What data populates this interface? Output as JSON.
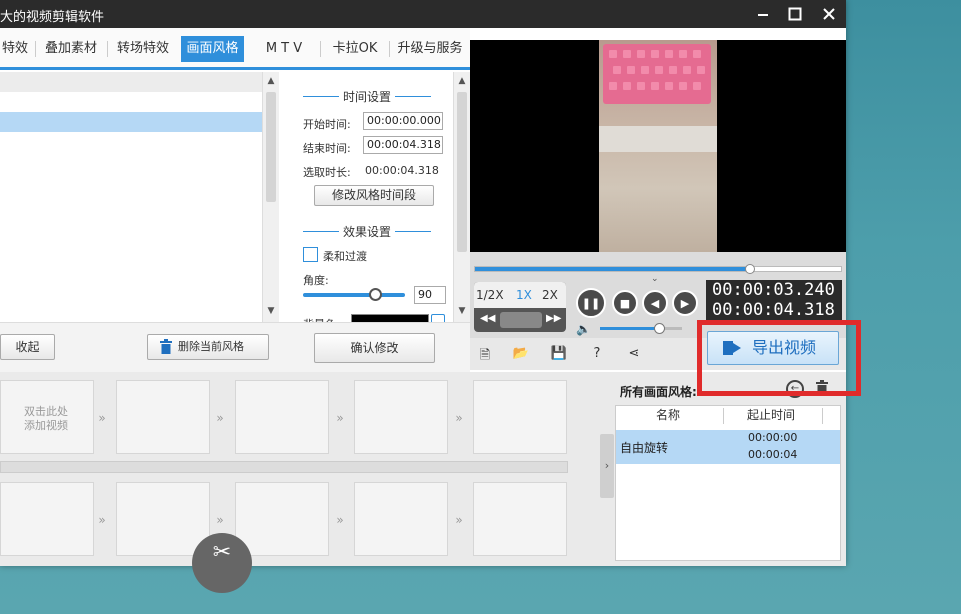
{
  "window": {
    "title": "大的视频剪辑软件"
  },
  "tabs": [
    "特效",
    "叠加素材",
    "转场特效",
    "画面风格",
    "M T V",
    "卡拉OK",
    "升级与服务"
  ],
  "settings": {
    "time_header": "时间设置",
    "start_label": "开始时间:",
    "start_value": "00:00:00.000",
    "end_label": "结束时间:",
    "end_value": "00:00:04.318",
    "duration_label": "选取时长:",
    "duration_value": "00:00:04.318",
    "modify_segment_btn": "修改风格时间段",
    "effect_header": "效果设置",
    "soft_transition": "柔和过渡",
    "angle_label": "角度:",
    "angle_value": "90",
    "bg_label": "背景色:",
    "confirm_btn": "确认修改"
  },
  "bottom": {
    "collapse_btn": "收起",
    "delete_btn": "删除当前风格"
  },
  "player": {
    "speed_half": "1/2X",
    "speed_1x": "1X",
    "speed_2x": "2X",
    "current_time": "00:00:03.240",
    "total_time": "00:00:04.318",
    "progress": 0.75,
    "volume": 0.72
  },
  "export_btn": "导出视频",
  "timeline": {
    "add_hint": "双击此处\n添加视频"
  },
  "style_panel": {
    "title": "所有画面风格:",
    "col_name": "名称",
    "col_time": "起止时间",
    "row_name": "自由旋转",
    "row_start": "00:00:00",
    "row_end": "00:00:04"
  },
  "colors": {
    "accent": "#2f8fdb",
    "highlight": "#e02b2b"
  },
  "icons": [
    "minimize-icon",
    "maximize-icon",
    "close-icon",
    "trash-icon",
    "pause-icon",
    "stop-icon",
    "prev-icon",
    "next-icon",
    "volume-icon",
    "new-file-icon",
    "open-folder-icon",
    "save-icon",
    "help-icon",
    "share-icon",
    "export-icon",
    "scissors-icon",
    "back-icon"
  ]
}
